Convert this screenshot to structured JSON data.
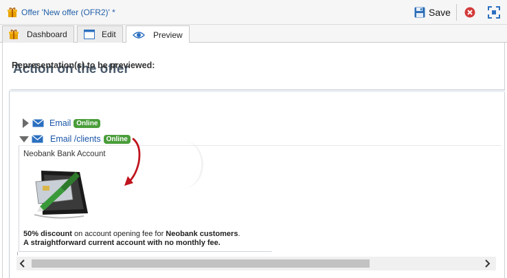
{
  "window": {
    "title": "Offer 'New offer (OFR2)' *",
    "save_label": "Save"
  },
  "tabs": [
    {
      "label": "Dashboard",
      "icon": "gift-icon"
    },
    {
      "label": "Edit",
      "icon": "window-icon"
    },
    {
      "label": "Preview",
      "icon": "eye-icon",
      "active": true
    }
  ],
  "main": {
    "heading": "Action on the offer",
    "representations_label": "Representation(s) to be previewed:",
    "items": [
      {
        "label": "Email",
        "status": "Online",
        "expanded": false
      },
      {
        "label": "Email /clients",
        "status": "Online",
        "expanded": true
      }
    ],
    "preview": {
      "title": "Neobank Bank Account",
      "line1_bold_a": "50% discount",
      "line1_mid": " on account opening fee for ",
      "line1_bold_b": "Neobank customers",
      "line1_end": ".",
      "line2": "A straightforward current account with no monthly fee."
    }
  },
  "colors": {
    "link": "#1a56a8",
    "badge": "#4a9d3a",
    "arrow": "#c0141e",
    "heading": "#4a5a6b"
  }
}
